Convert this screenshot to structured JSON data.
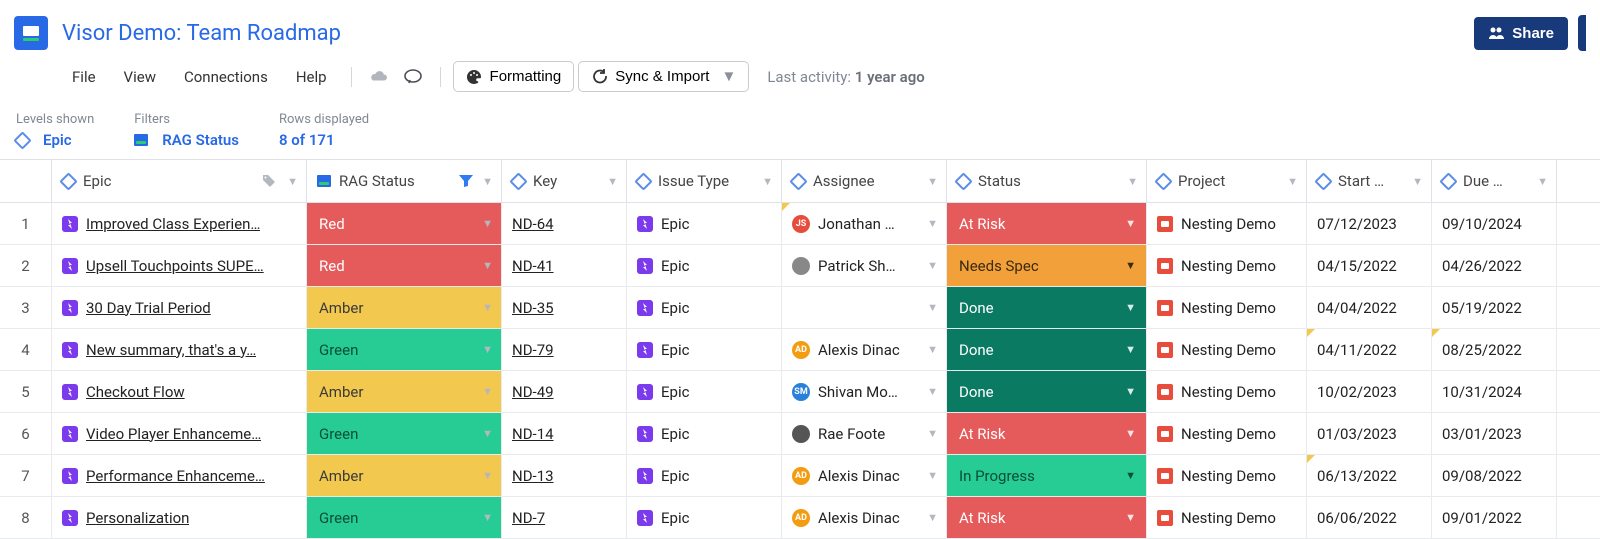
{
  "title": "Visor Demo: Team Roadmap",
  "share_label": "Share",
  "menu": {
    "file": "File",
    "view": "View",
    "connections": "Connections",
    "help": "Help"
  },
  "toolbar": {
    "formatting": "Formatting",
    "sync_import": "Sync & Import"
  },
  "activity": {
    "label": "Last activity:",
    "value": "1 year ago"
  },
  "filters": {
    "levels": {
      "label": "Levels shown",
      "value": "Epic"
    },
    "filters": {
      "label": "Filters",
      "value": "RAG Status"
    },
    "rows": {
      "label": "Rows displayed",
      "value": "8 of 171"
    }
  },
  "columns": {
    "epic": "Epic",
    "rag": "RAG Status",
    "key": "Key",
    "issue_type": "Issue Type",
    "assignee": "Assignee",
    "status": "Status",
    "project": "Project",
    "start": "Start …",
    "due": "Due …"
  },
  "rag_colors": {
    "Red": "rag-red",
    "Amber": "rag-amber",
    "Green": "rag-green"
  },
  "status_colors": {
    "At Risk": "st-atrisk",
    "Needs Spec": "st-needspec",
    "Done": "st-done",
    "In Progress": "st-inprogress"
  },
  "rows": [
    {
      "n": "1",
      "epic": "Improved Class Experien…",
      "rag": "Red",
      "key": "ND-64",
      "issue_type": "Epic",
      "assignee": {
        "name": "Jonathan …",
        "initials": "JS",
        "color": "#e74c3c"
      },
      "assignee_corner": true,
      "status": "At Risk",
      "project": "Nesting Demo",
      "start": "07/12/2023",
      "due": "09/10/2024"
    },
    {
      "n": "2",
      "epic": "Upsell Touchpoints SUPE…",
      "rag": "Red",
      "key": "ND-41",
      "issue_type": "Epic",
      "assignee": {
        "name": "Patrick Sh…",
        "initials": "",
        "color": "#888",
        "photo": true
      },
      "status": "Needs Spec",
      "project": "Nesting Demo",
      "start": "04/15/2022",
      "due": "04/26/2022"
    },
    {
      "n": "3",
      "epic": "30 Day Trial Period",
      "rag": "Amber",
      "key": "ND-35",
      "issue_type": "Epic",
      "assignee": null,
      "status": "Done",
      "project": "Nesting Demo",
      "start": "04/04/2022",
      "due": "05/19/2022"
    },
    {
      "n": "4",
      "epic": "New summary, that's a y…",
      "rag": "Green",
      "key": "ND-79",
      "issue_type": "Epic",
      "assignee": {
        "name": "Alexis Dinac",
        "initials": "AD",
        "color": "#f39c12"
      },
      "status": "Done",
      "project": "Nesting Demo",
      "start": "04/11/2022",
      "start_corner": true,
      "due": "08/25/2022",
      "due_corner": true
    },
    {
      "n": "5",
      "epic": "Checkout Flow",
      "rag": "Amber",
      "key": "ND-49",
      "issue_type": "Epic",
      "assignee": {
        "name": "Shivan Mo…",
        "initials": "SM",
        "color": "#2980d9"
      },
      "status": "Done",
      "project": "Nesting Demo",
      "start": "10/02/2023",
      "due": "10/31/2024"
    },
    {
      "n": "6",
      "epic": "Video Player Enhanceme…",
      "rag": "Green",
      "key": "ND-14",
      "issue_type": "Epic",
      "assignee": {
        "name": "Rae Foote",
        "initials": "",
        "color": "#555",
        "photo": true
      },
      "status": "At Risk",
      "project": "Nesting Demo",
      "start": "01/03/2023",
      "due": "03/01/2023"
    },
    {
      "n": "7",
      "epic": "Performance Enhanceme…",
      "rag": "Amber",
      "key": "ND-13",
      "issue_type": "Epic",
      "assignee": {
        "name": "Alexis Dinac",
        "initials": "AD",
        "color": "#f39c12"
      },
      "status": "In Progress",
      "project": "Nesting Demo",
      "start": "06/13/2022",
      "start_corner": true,
      "due": "09/08/2022"
    },
    {
      "n": "8",
      "epic": "Personalization",
      "rag": "Green",
      "key": "ND-7",
      "issue_type": "Epic",
      "assignee": {
        "name": "Alexis Dinac",
        "initials": "AD",
        "color": "#f39c12"
      },
      "status": "At Risk",
      "project": "Nesting Demo",
      "start": "06/06/2022",
      "due": "09/01/2022"
    }
  ]
}
